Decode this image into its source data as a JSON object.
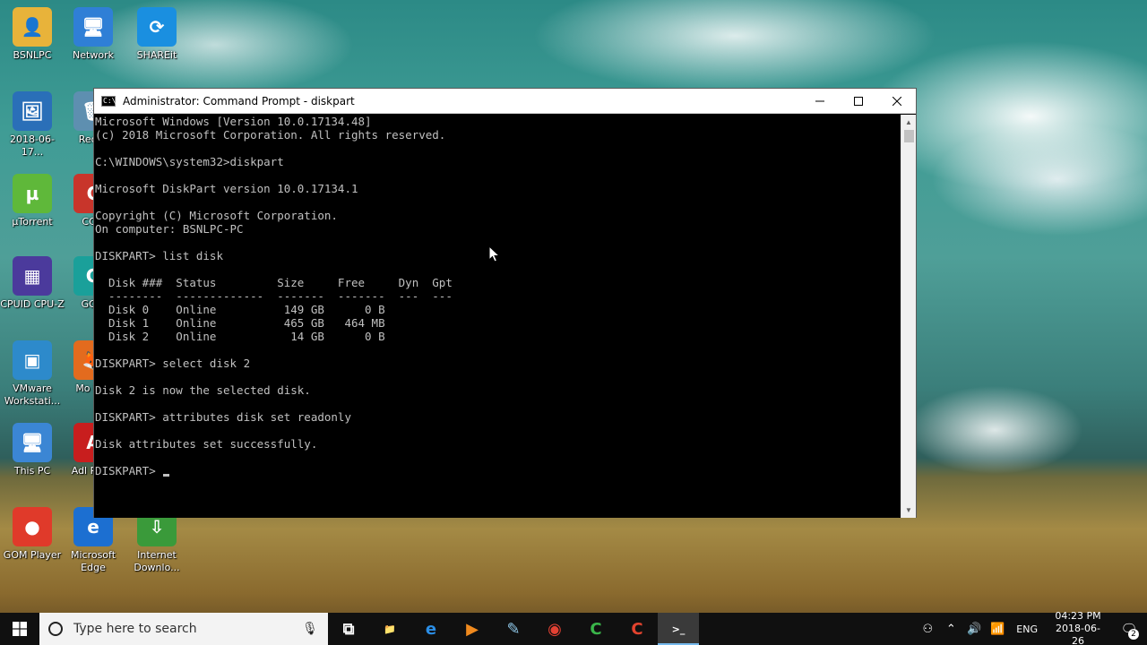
{
  "desktop": {
    "icons": [
      {
        "label": "BSNLPC",
        "color": "#e8b33a",
        "glyph": "👤"
      },
      {
        "label": "Network",
        "color": "#2f7fd6",
        "glyph": "🖥"
      },
      {
        "label": "SHAREit",
        "color": "#1a8fe0",
        "glyph": "⟳"
      },
      {
        "label": "2018-06-17...",
        "color": "#2a6fb8",
        "glyph": "🖼"
      },
      {
        "label": "Recyc",
        "color": "#5e8fb0",
        "glyph": "🗑"
      },
      {
        "label": "µTorrent",
        "color": "#5fb83a",
        "glyph": "µ"
      },
      {
        "label": "CCle",
        "color": "#c8352b",
        "glyph": "C"
      },
      {
        "label": "CPUID CPU-Z",
        "color": "#4b3a9c",
        "glyph": "▦"
      },
      {
        "label": "GOM",
        "color": "#1aa09a",
        "glyph": "G"
      },
      {
        "label": "VMware Workstati...",
        "color": "#2d8acb",
        "glyph": "▣"
      },
      {
        "label": "Mo Fire",
        "color": "#e36b1e",
        "glyph": "🦊"
      },
      {
        "label": "This PC",
        "color": "#3b86d4",
        "glyph": "🖥"
      },
      {
        "label": "Adl Read",
        "color": "#c81e1e",
        "glyph": "A"
      },
      {
        "label": "GOM Player",
        "color": "#e03a2a",
        "glyph": "●"
      },
      {
        "label": "Microsoft Edge",
        "color": "#1c6fd1",
        "glyph": "e"
      },
      {
        "label": "Internet Downlo...",
        "color": "#3a9a3a",
        "glyph": "⇩"
      }
    ]
  },
  "window": {
    "title": "Administrator: Command Prompt - diskpart",
    "minimize_icon": "minimize-icon",
    "maximize_icon": "maximize-icon",
    "close_icon": "close-icon",
    "console_lines": [
      "Microsoft Windows [Version 10.0.17134.48]",
      "(c) 2018 Microsoft Corporation. All rights reserved.",
      "",
      "C:\\WINDOWS\\system32>diskpart",
      "",
      "Microsoft DiskPart version 10.0.17134.1",
      "",
      "Copyright (C) Microsoft Corporation.",
      "On computer: BSNLPC-PC",
      "",
      "DISKPART> list disk",
      "",
      "  Disk ###  Status         Size     Free     Dyn  Gpt",
      "  --------  -------------  -------  -------  ---  ---",
      "  Disk 0    Online          149 GB      0 B",
      "  Disk 1    Online          465 GB   464 MB",
      "  Disk 2    Online           14 GB      0 B",
      "",
      "DISKPART> select disk 2",
      "",
      "Disk 2 is now the selected disk.",
      "",
      "DISKPART> attributes disk set readonly",
      "",
      "Disk attributes set successfully.",
      "",
      "DISKPART> "
    ]
  },
  "taskbar": {
    "search_placeholder": "Type here to search",
    "apps": [
      {
        "name": "task-view",
        "glyph": "⧉",
        "color": "#ffffff"
      },
      {
        "name": "file-explorer",
        "glyph": "📁",
        "color": "#f2c744"
      },
      {
        "name": "edge",
        "glyph": "e",
        "color": "#2b8ee6"
      },
      {
        "name": "media-player",
        "glyph": "▶",
        "color": "#f08a1e"
      },
      {
        "name": "notepad",
        "glyph": "✎",
        "color": "#8fc7e8"
      },
      {
        "name": "chrome",
        "glyph": "◉",
        "color": "#e34133"
      },
      {
        "name": "camtasia-green",
        "glyph": "C",
        "color": "#3ab54a"
      },
      {
        "name": "camtasia-red",
        "glyph": "C",
        "color": "#e2432e"
      },
      {
        "name": "command-prompt",
        "glyph": ">_",
        "color": "#ffffff",
        "active": true
      }
    ],
    "tray": {
      "lang": "ENG",
      "time": "04:23 PM",
      "date": "2018-06-26",
      "notification_count": "2"
    }
  }
}
